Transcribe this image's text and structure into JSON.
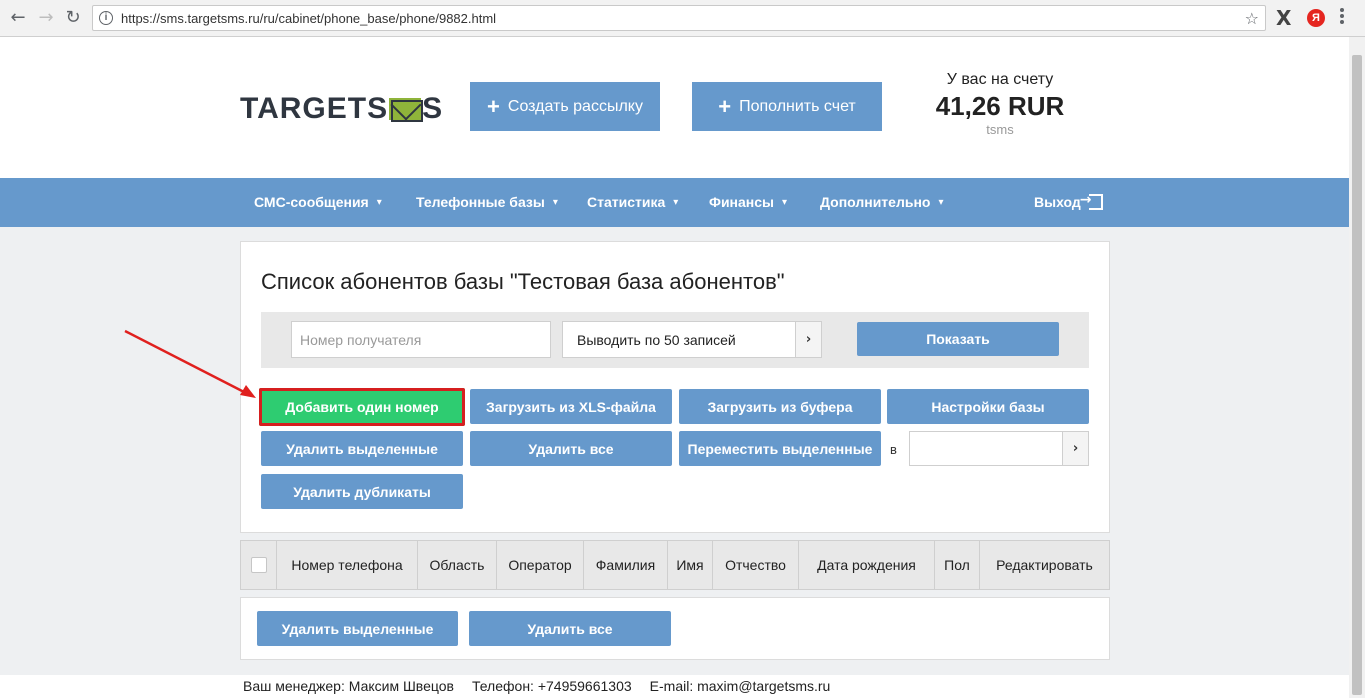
{
  "browser": {
    "url": "https://sms.targetsms.ru/ru/cabinet/phone_base/phone/9882.html",
    "ext_x": "X",
    "ext_y": "Я"
  },
  "header": {
    "logo_left": "TARGETS",
    "logo_right": "S",
    "create_label": "Создать рассылку",
    "topup_label": "Пополнить счет",
    "balance_label": "У вас на счету",
    "balance_amount": "41,26 RUR",
    "balance_user": "tsms"
  },
  "menu": {
    "items": [
      {
        "label": "СМС-сообщения"
      },
      {
        "label": "Телефонные базы"
      },
      {
        "label": "Статистика"
      },
      {
        "label": "Финансы"
      },
      {
        "label": "Дополнительно"
      }
    ],
    "exit_label": "Выход"
  },
  "content": {
    "title": "Список абонентов базы \"Тестовая база абонентов\"",
    "search_placeholder": "Номер получателя",
    "per_page": "Выводить по 50 записей",
    "show_label": "Показать",
    "add_one": "Добавить один номер",
    "upload_xls": "Загрузить из XLS-файла",
    "upload_buffer": "Загрузить из буфера",
    "base_settings": "Настройки базы",
    "delete_selected": "Удалить выделенные",
    "delete_all": "Удалить все",
    "move_selected": "Переместить выделенные",
    "in_label": "в",
    "delete_duplicates": "Удалить дубликаты"
  },
  "table": {
    "columns": [
      "Номер телефона",
      "Область",
      "Оператор",
      "Фамилия",
      "Имя",
      "Отчество",
      "Дата рождения",
      "Пол",
      "Редактировать"
    ]
  },
  "bottom": {
    "delete_selected": "Удалить выделенные",
    "delete_all": "Удалить все"
  },
  "footer": {
    "manager": "Ваш менеджер: Максим Швецов",
    "phone": "Телефон: +74959661303",
    "email": "E-mail: maxim@targetsms.ru"
  },
  "colors": {
    "primary": "#6699cc",
    "success": "#2ecc71",
    "highlight": "#d61f1f"
  }
}
